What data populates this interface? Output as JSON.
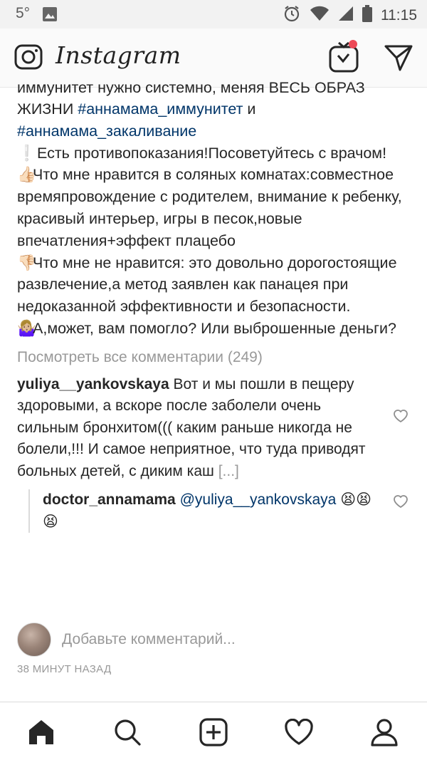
{
  "status_bar": {
    "temperature": "5°",
    "time": "11:15"
  },
  "app_bar": {
    "logo": "Instagram",
    "icons": [
      "camera-icon",
      "igtv-icon",
      "direct-message-icon"
    ]
  },
  "post": {
    "caption_lines": {
      "cut_top": "иммунитет нужно системно, меняя ВЕСЬ ОБРАЗ",
      "line_a": "ЖИЗНИ ",
      "hashtag_1": "#аннамама_иммунитет",
      "line_a_end": " и",
      "hashtag_2": "#аннамама_закаливание",
      "warn_emoji": "❕",
      "warn_text": "Есть противопоказания!Посоветуйтесь с врачом!",
      "like_emoji": "👍🏻",
      "like_text": "Что мне нравится в соляных комнатах:совместное времяпровождение с родителем, внимание к ребенку, красивый интерьер, игры в песок,новые впечатления+эффект плацебо",
      "dislike_emoji": "👎🏻",
      "dislike_text": "Что мне не нравится: это довольно дорогостоящие развлечение,а метод заявлен как панацея при недоказанной эффективности и безопасности.",
      "shrug_emoji": "🤷🏼‍♀️",
      "shrug_text": "А,может, вам помогло? Или выброшенные деньги?"
    },
    "view_all_comments": "Посмотреть все комментарии (249)",
    "comment": {
      "user": "yuliya__yankovskaya",
      "text": "Вот и мы пошли в пещеру здоровыми, а вскоре после заболели очень сильным бронхитом((( каким раньше никогда не болели,!!! И самое неприятное, что туда приводят больных детей, с диким каш",
      "more": "[...]"
    },
    "reply": {
      "user": "doctor_annamama",
      "mention": "@yuliya__yankovskaya",
      "emojis": "😫😫😫"
    },
    "add_comment_placeholder": "Добавьте комментарий...",
    "timestamp": "38 МИНУТ НАЗАД"
  },
  "tab_bar": {
    "tabs": [
      "home-icon",
      "search-icon",
      "add-post-icon",
      "activity-heart-icon",
      "profile-icon"
    ]
  },
  "colors": {
    "hashtag": "#003569",
    "muted": "#999999",
    "notification_dot": "#ed4956"
  }
}
